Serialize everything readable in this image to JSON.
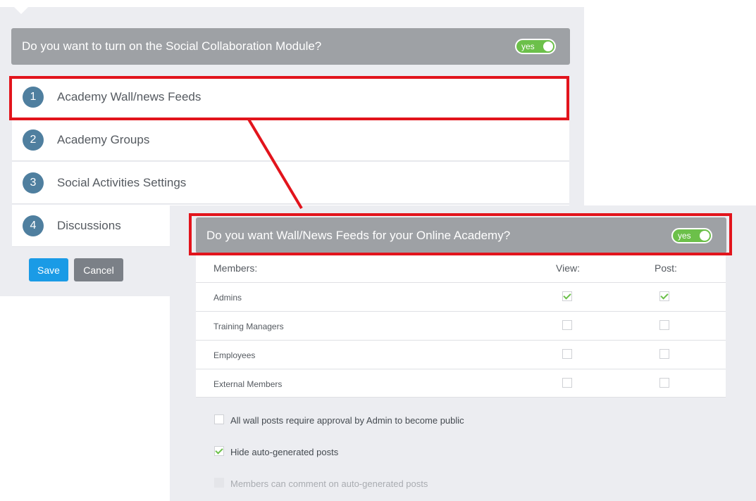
{
  "module_question": "Do you want to turn on the Social Collaboration Module?",
  "module_toggle": "yes",
  "steps": [
    {
      "num": "1",
      "label": "Academy Wall/news Feeds"
    },
    {
      "num": "2",
      "label": "Academy Groups"
    },
    {
      "num": "3",
      "label": "Social Activities Settings"
    },
    {
      "num": "4",
      "label": "Discussions"
    }
  ],
  "buttons": {
    "save": "Save",
    "cancel": "Cancel"
  },
  "feeds_question": "Do you want Wall/News Feeds for your Online Academy?",
  "feeds_toggle": "yes",
  "table": {
    "headers": {
      "members": "Members:",
      "view": "View:",
      "post": "Post:"
    },
    "rows": [
      {
        "name": "Admins",
        "view": true,
        "post": true
      },
      {
        "name": "Training Managers",
        "view": false,
        "post": false
      },
      {
        "name": "Employees",
        "view": false,
        "post": false
      },
      {
        "name": "External Members",
        "view": false,
        "post": false
      }
    ]
  },
  "options": [
    {
      "label": "All wall posts require approval by Admin to become public",
      "checked": false,
      "disabled": false
    },
    {
      "label": "Hide auto-generated posts",
      "checked": true,
      "disabled": false
    },
    {
      "label": "Members can comment on auto-generated posts",
      "checked": false,
      "disabled": true
    }
  ],
  "colors": {
    "accent_red": "#e2141c",
    "toggle_green": "#6cc04a",
    "save_blue": "#1a9be6",
    "step_blue": "#4f7f9f"
  }
}
